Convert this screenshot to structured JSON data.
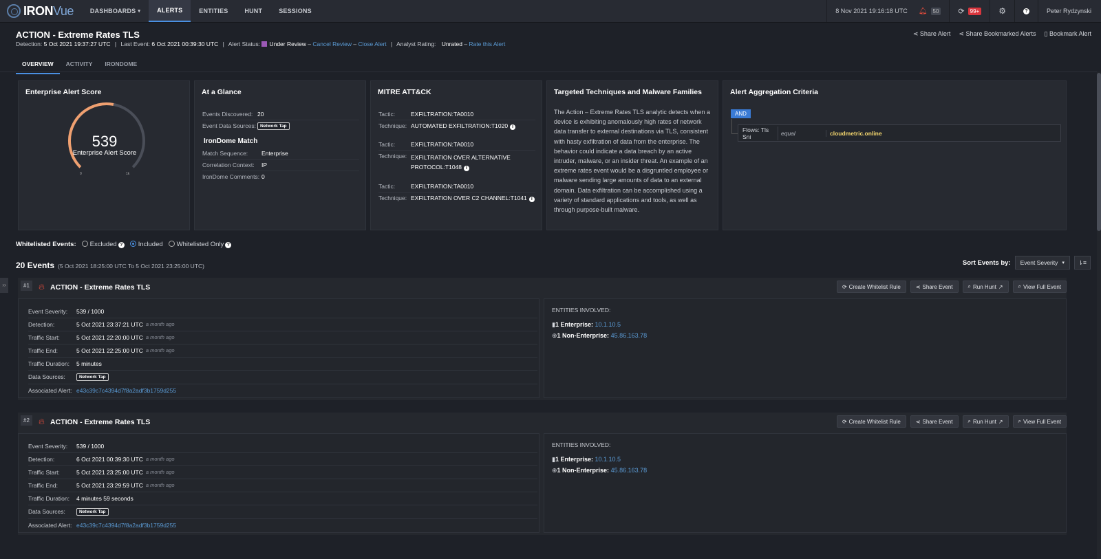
{
  "nav": {
    "logo_iron": "IRON",
    "logo_vue": "Vue",
    "items": [
      {
        "label": "DASHBOARDS",
        "dropdown": true
      },
      {
        "label": "ALERTS",
        "active": true
      },
      {
        "label": "ENTITIES"
      },
      {
        "label": "HUNT"
      },
      {
        "label": "SESSIONS"
      }
    ],
    "datetime": "8 Nov 2021 19:16:18 UTC",
    "alerts_count": "50",
    "refresh_count": "99+",
    "user": "Peter Rydzynski"
  },
  "alert": {
    "title": "ACTION - Extreme Rates TLS",
    "detection_label": "Detection:",
    "detection": "5 Oct 2021 19:37:27 UTC",
    "last_event_label": "Last Event:",
    "last_event": "6 Oct 2021 00:39:30 UTC",
    "status_label": "Alert Status:",
    "status": "Under Review",
    "cancel_review": "Cancel Review",
    "close_alert": "Close Alert",
    "rating_label": "Analyst Rating:",
    "rating": "Unrated",
    "rate_link": "Rate this Alert",
    "sep": "|",
    "dash": "–"
  },
  "share": {
    "share_alert": "Share Alert",
    "share_bookmarked": "Share Bookmarked Alerts",
    "bookmark": "Bookmark Alert"
  },
  "tabs": [
    "OVERVIEW",
    "ACTIVITY",
    "IRONDOME"
  ],
  "score_panel": {
    "title": "Enterprise Alert Score",
    "score": "539",
    "score_label": "Enterprise Alert Score",
    "min": "0",
    "max": "1k",
    "fraction": 0.539
  },
  "glance": {
    "title": "At a Glance",
    "events_label": "Events Discovered:",
    "events": "20",
    "sources_label": "Event Data Sources:",
    "source_tag": "Network Tap",
    "irondome_title": "IronDome Match",
    "match_seq_label": "Match Sequence:",
    "match_seq": "Enterprise",
    "corr_label": "Correlation Context:",
    "corr": "IP",
    "comments_label": "IronDome Comments:",
    "comments": "0"
  },
  "mitre": {
    "title": "MITRE ATT&CK",
    "tactic_label": "Tactic:",
    "technique_label": "Technique:",
    "groups": [
      {
        "tactic": "EXFILTRATION:TA0010",
        "technique": "AUTOMATED EXFILTRATION:T1020"
      },
      {
        "tactic": "EXFILTRATION:TA0010",
        "technique": "EXFILTRATION OVER ALTERNATIVE PROTOCOL:T1048"
      },
      {
        "tactic": "EXFILTRATION:TA0010",
        "technique": "EXFILTRATION OVER C2 CHANNEL:T1041"
      }
    ]
  },
  "targeted": {
    "title": "Targeted Techniques and Malware Families",
    "text": "The Action – Extreme Rates TLS analytic detects when a device is exhibiting anomalously high rates of network data transfer to external destinations via TLS, consistent with hasty exfiltration of data from the enterprise. The behavior could indicate a data breach by an active intruder, malware, or an insider threat. An example of an extreme rates event would be a disgruntled employee or malware sending large amounts of data to an external domain. Data exfiltration can be accomplished using a variety of standard applications and tools, as well as through purpose-built malware."
  },
  "aggregation": {
    "title": "Alert Aggregation Criteria",
    "operator": "AND",
    "field": "Flows: Tls Sni",
    "comparator": "equal",
    "value": "cloudmetric.online"
  },
  "whitelist": {
    "label": "Whitelisted Events:",
    "options": [
      "Excluded",
      "Included",
      "Whitelisted Only"
    ],
    "selected": "Included"
  },
  "events_header": {
    "count": "20 Events",
    "range": "(5 Oct 2021 18:25:00 UTC To 5 Oct 2021 23:25:00 UTC)",
    "sort_label": "Sort Events by:",
    "sort_value": "Event Severity"
  },
  "buttons": {
    "whitelist": "Create Whitelist Rule",
    "share": "Share Event",
    "hunt": "Run Hunt",
    "full": "View Full Event"
  },
  "labels": {
    "severity": "Event Severity:",
    "detection": "Detection:",
    "traffic_start": "Traffic Start:",
    "traffic_end": "Traffic End:",
    "duration": "Traffic Duration:",
    "sources": "Data Sources:",
    "assoc": "Associated Alert:",
    "entities": "ENTITIES INVOLVED:",
    "enterprise": "1 Enterprise:",
    "non_enterprise": "1 Non-Enterprise:"
  },
  "events": [
    {
      "num": "#1",
      "title": "ACTION - Extreme Rates TLS",
      "severity": "539 / 1000",
      "detection": "5 Oct 2021 23:37:21 UTC",
      "traffic_start": "5 Oct 2021 22:20:00 UTC",
      "traffic_end": "5 Oct 2021 22:25:00 UTC",
      "ago": "a month ago",
      "duration": "5 minutes",
      "source_tag": "Network Tap",
      "assoc": "e43c39c7c4394d7f8a2adf3b1759d255",
      "enterprise_ip": "10.1.10.5",
      "non_enterprise_ip": "45.86.163.78"
    },
    {
      "num": "#2",
      "title": "ACTION - Extreme Rates TLS",
      "severity": "539 / 1000",
      "detection": "6 Oct 2021 00:39:30 UTC",
      "traffic_start": "5 Oct 2021 23:25:00 UTC",
      "traffic_end": "5 Oct 2021 23:29:59 UTC",
      "ago": "a month ago",
      "duration": "4 minutes 59 seconds",
      "source_tag": "Network Tap",
      "assoc": "e43c39c7c4394d7f8a2adf3b1759d255",
      "enterprise_ip": "10.1.10.5",
      "non_enterprise_ip": "45.86.163.78"
    }
  ]
}
